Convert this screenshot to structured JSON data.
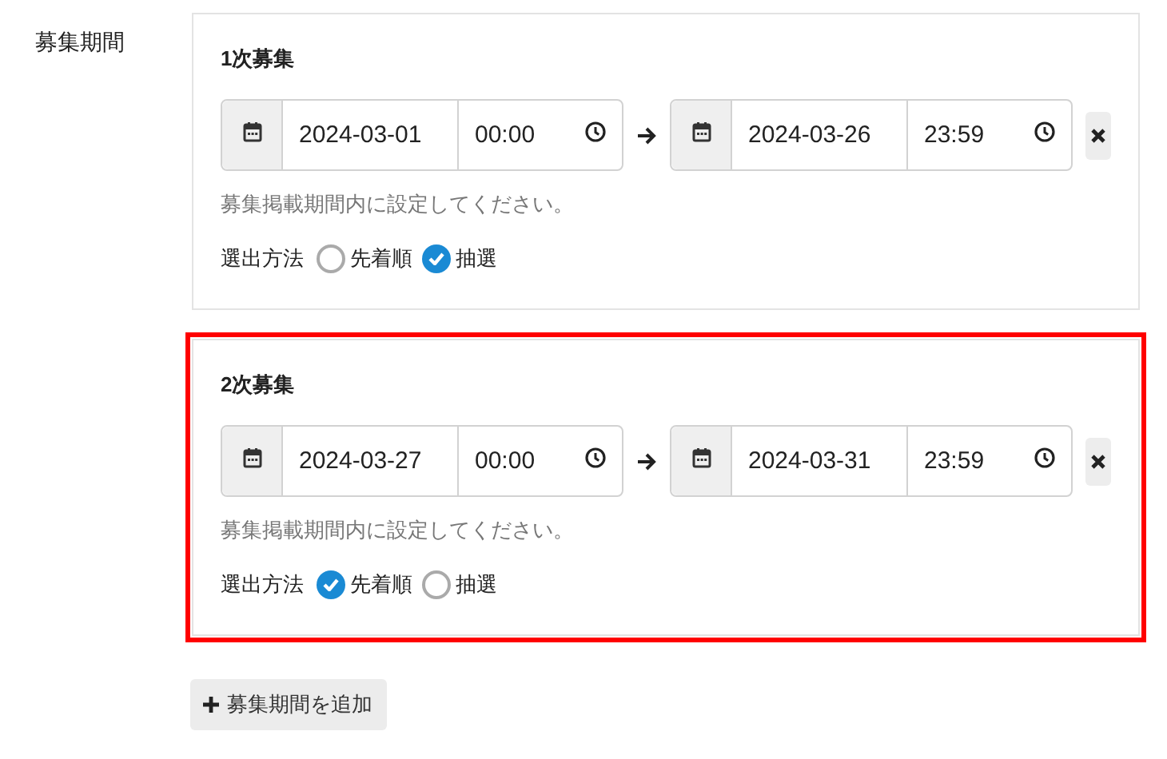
{
  "field_label": "募集期間",
  "periods": [
    {
      "title": "1次募集",
      "highlighted": false,
      "start": {
        "date": "2024-03-01",
        "time": "00:00"
      },
      "end": {
        "date": "2024-03-26",
        "time": "23:59"
      },
      "hint": "募集掲載期間内に設定してください。",
      "method_label": "選出方法",
      "options": [
        {
          "label": "先着順",
          "selected": false
        },
        {
          "label": "抽選",
          "selected": true
        }
      ]
    },
    {
      "title": "2次募集",
      "highlighted": true,
      "start": {
        "date": "2024-03-27",
        "time": "00:00"
      },
      "end": {
        "date": "2024-03-31",
        "time": "23:59"
      },
      "hint": "募集掲載期間内に設定してください。",
      "method_label": "選出方法",
      "options": [
        {
          "label": "先着順",
          "selected": true
        },
        {
          "label": "抽選",
          "selected": false
        }
      ]
    }
  ],
  "add_button": "募集期間を追加"
}
